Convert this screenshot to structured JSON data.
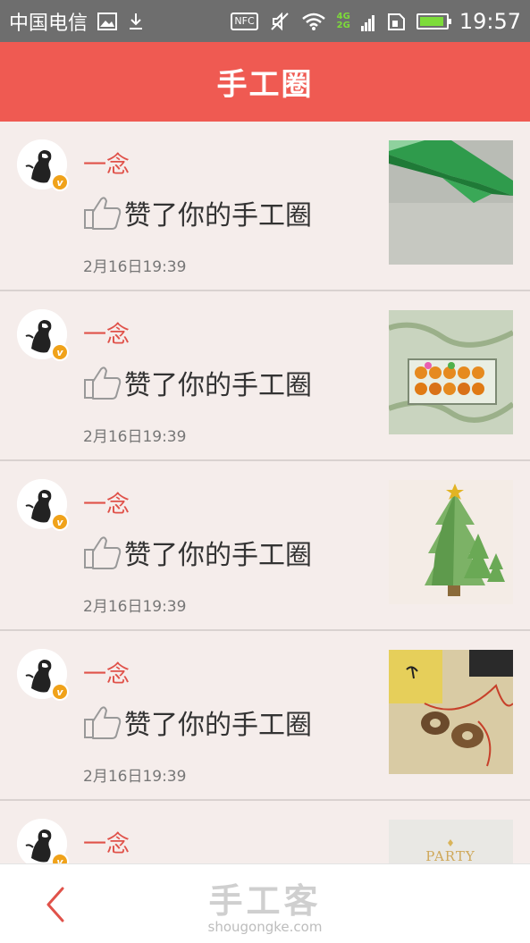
{
  "status_bar": {
    "carrier": "中国电信",
    "nfc": "NFC",
    "net_4g": "4G",
    "net_2g": "2G",
    "time": "19:57"
  },
  "header": {
    "title": "手工圈"
  },
  "notifications": [
    {
      "username": "一念",
      "action_text": "赞了你的手工圈",
      "timestamp": "2月16日19:39",
      "photo": "paper-plane-photo"
    },
    {
      "username": "一念",
      "action_text": "赞了你的手工圈",
      "timestamp": "2月16日19:39",
      "photo": "cookies-tray-photo"
    },
    {
      "username": "一念",
      "action_text": "赞了你的手工圈",
      "timestamp": "2月16日19:39",
      "photo": "clay-tree-photo"
    },
    {
      "username": "一念",
      "action_text": "赞了你的手工圈",
      "timestamp": "2月16日19:39",
      "photo": "wooden-beads-photo"
    },
    {
      "username": "一念",
      "action_text": "",
      "timestamp": "",
      "photo": "party-card-photo"
    }
  ],
  "photo_texts": {
    "party": "PARTY"
  },
  "bottom": {
    "watermark_cn": "手工客",
    "watermark_en": "shougongke.com"
  },
  "colors": {
    "accent": "#ef5a52",
    "username": "#e0524a",
    "badge": "#f0a21a"
  }
}
